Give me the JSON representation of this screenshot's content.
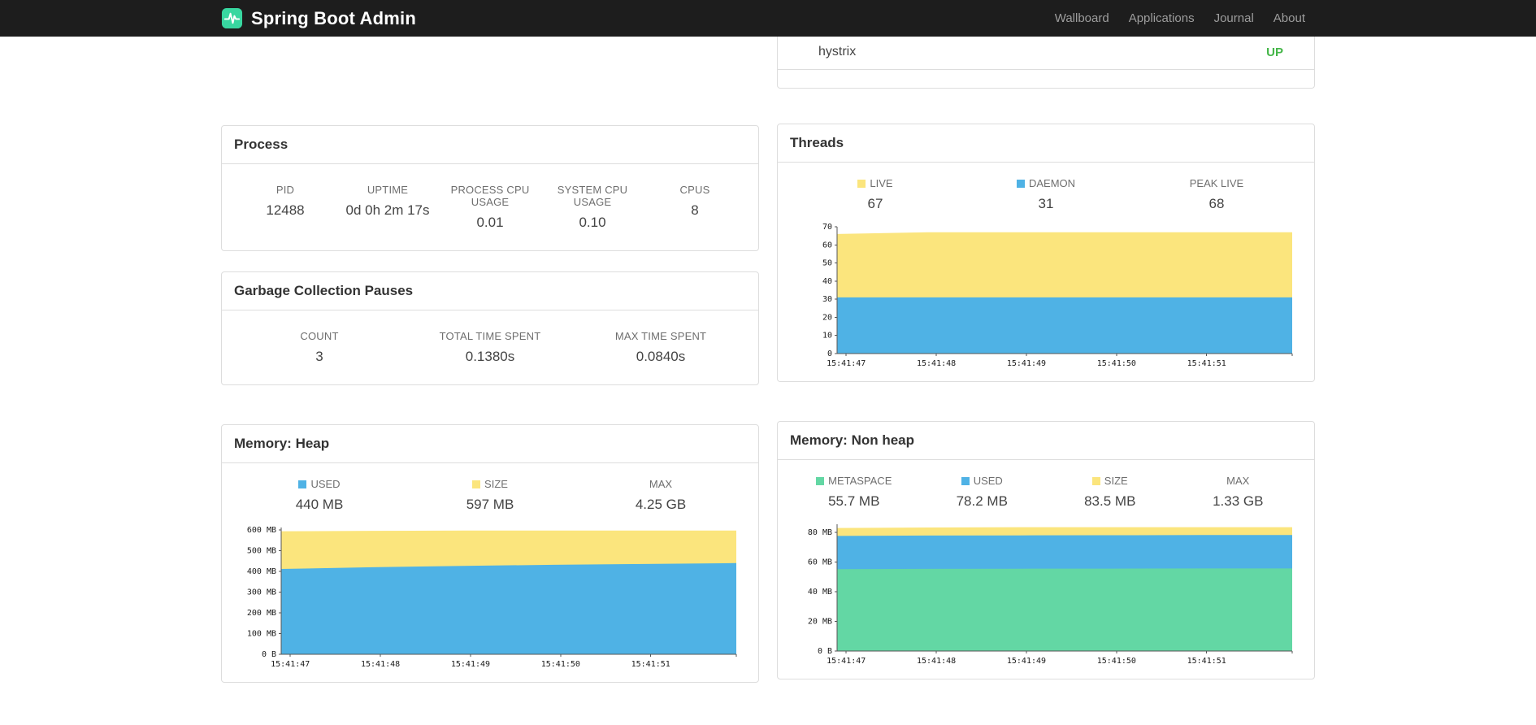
{
  "navbar": {
    "brand": "Spring Boot Admin",
    "links": [
      {
        "label": "Wallboard"
      },
      {
        "label": "Applications"
      },
      {
        "label": "Journal"
      },
      {
        "label": "About"
      }
    ]
  },
  "colors": {
    "navbar_bg": "#1d1d1d",
    "brand_logo": "#38d7a0",
    "status_up": "#45b649",
    "chart_blue": "#4fb2e5",
    "chart_yellow": "#fbe57d",
    "chart_green": "#63d7a4"
  },
  "health_panel": {
    "row": {
      "label": "hystrix",
      "status": "UP"
    }
  },
  "panels": {
    "process": {
      "title": "Process",
      "stats": [
        {
          "label": "PID",
          "value": "12488"
        },
        {
          "label": "UPTIME",
          "value": "0d 0h 2m 17s"
        },
        {
          "label": "PROCESS CPU USAGE",
          "value": "0.01"
        },
        {
          "label": "SYSTEM CPU USAGE",
          "value": "0.10"
        },
        {
          "label": "CPUS",
          "value": "8"
        }
      ]
    },
    "gc": {
      "title": "Garbage Collection Pauses",
      "stats": [
        {
          "label": "COUNT",
          "value": "3"
        },
        {
          "label": "TOTAL TIME SPENT",
          "value": "0.1380s"
        },
        {
          "label": "MAX TIME SPENT",
          "value": "0.0840s"
        }
      ]
    },
    "threads": {
      "title": "Threads",
      "legend": [
        {
          "label": "LIVE",
          "value": "67",
          "color": "#fbe57d"
        },
        {
          "label": "DAEMON",
          "value": "31",
          "color": "#4fb2e5"
        },
        {
          "label": "PEAK LIVE",
          "value": "68"
        }
      ]
    },
    "memory_heap": {
      "title": "Memory: Heap",
      "legend": [
        {
          "label": "USED",
          "value": "440 MB",
          "color": "#4fb2e5"
        },
        {
          "label": "SIZE",
          "value": "597 MB",
          "color": "#fbe57d"
        },
        {
          "label": "MAX",
          "value": "4.25 GB"
        }
      ]
    },
    "memory_nonheap": {
      "title": "Memory: Non heap",
      "legend": [
        {
          "label": "METASPACE",
          "value": "55.7 MB",
          "color": "#63d7a4"
        },
        {
          "label": "USED",
          "value": "78.2 MB",
          "color": "#4fb2e5"
        },
        {
          "label": "SIZE",
          "value": "83.5 MB",
          "color": "#fbe57d"
        },
        {
          "label": "MAX",
          "value": "1.33 GB"
        }
      ]
    }
  },
  "chart_data": [
    {
      "type": "area",
      "stacked": true,
      "title": "Threads",
      "values_are": "stack_top",
      "x_ticks": [
        "15:41:47",
        "15:41:48",
        "15:41:49",
        "15:41:50",
        "15:41:51"
      ],
      "ylim": [
        0,
        70
      ],
      "y_ticks": [
        {
          "v": 0,
          "label": "0"
        },
        {
          "v": 10,
          "label": "10"
        },
        {
          "v": 20,
          "label": "20"
        },
        {
          "v": 30,
          "label": "30"
        },
        {
          "v": 40,
          "label": "40"
        },
        {
          "v": 50,
          "label": "50"
        },
        {
          "v": 60,
          "label": "60"
        },
        {
          "v": 70,
          "label": "70"
        }
      ],
      "series": [
        {
          "name": "LIVE",
          "color": "#fbe57d",
          "values": [
            66,
            67,
            67,
            67,
            67,
            67
          ]
        },
        {
          "name": "DAEMON",
          "color": "#4fb2e5",
          "values": [
            31,
            31,
            31,
            31,
            31,
            31
          ]
        }
      ],
      "legend_position": "top",
      "grid": false
    },
    {
      "type": "area",
      "stacked": true,
      "title": "Memory: Heap (MB)",
      "values_are": "stack_top",
      "x_ticks": [
        "15:41:47",
        "15:41:48",
        "15:41:49",
        "15:41:50",
        "15:41:51"
      ],
      "ylim": [
        0,
        612
      ],
      "y_ticks": [
        {
          "v": 0,
          "label": "0 B"
        },
        {
          "v": 100,
          "label": "100 MB"
        },
        {
          "v": 200,
          "label": "200 MB"
        },
        {
          "v": 300,
          "label": "300 MB"
        },
        {
          "v": 400,
          "label": "400 MB"
        },
        {
          "v": 500,
          "label": "500 MB"
        },
        {
          "v": 600,
          "label": "600 MB"
        }
      ],
      "series": [
        {
          "name": "SIZE",
          "color": "#fbe57d",
          "values": [
            594,
            596,
            597,
            597,
            597,
            597
          ]
        },
        {
          "name": "USED",
          "color": "#4fb2e5",
          "values": [
            412,
            420,
            427,
            432,
            436,
            440
          ]
        }
      ],
      "legend_position": "top",
      "grid": false
    },
    {
      "type": "area",
      "stacked": true,
      "title": "Memory: Non heap (MB)",
      "values_are": "stack_top",
      "x_ticks": [
        "15:41:47",
        "15:41:48",
        "15:41:49",
        "15:41:50",
        "15:41:51"
      ],
      "ylim": [
        0,
        85.5
      ],
      "y_ticks": [
        {
          "v": 0,
          "label": "0 B"
        },
        {
          "v": 20,
          "label": "20 MB"
        },
        {
          "v": 40,
          "label": "40 MB"
        },
        {
          "v": 60,
          "label": "60 MB"
        },
        {
          "v": 80,
          "label": "80 MB"
        }
      ],
      "series": [
        {
          "name": "SIZE",
          "color": "#fbe57d",
          "values": [
            83,
            83.3,
            83.5,
            83.5,
            83.5,
            83.5
          ]
        },
        {
          "name": "USED",
          "color": "#4fb2e5",
          "values": [
            77.6,
            77.9,
            78,
            78.1,
            78.2,
            78.2
          ]
        },
        {
          "name": "METASPACE",
          "color": "#63d7a4",
          "values": [
            55.2,
            55.4,
            55.5,
            55.6,
            55.7,
            55.7
          ]
        }
      ],
      "legend_position": "top",
      "grid": false
    }
  ]
}
